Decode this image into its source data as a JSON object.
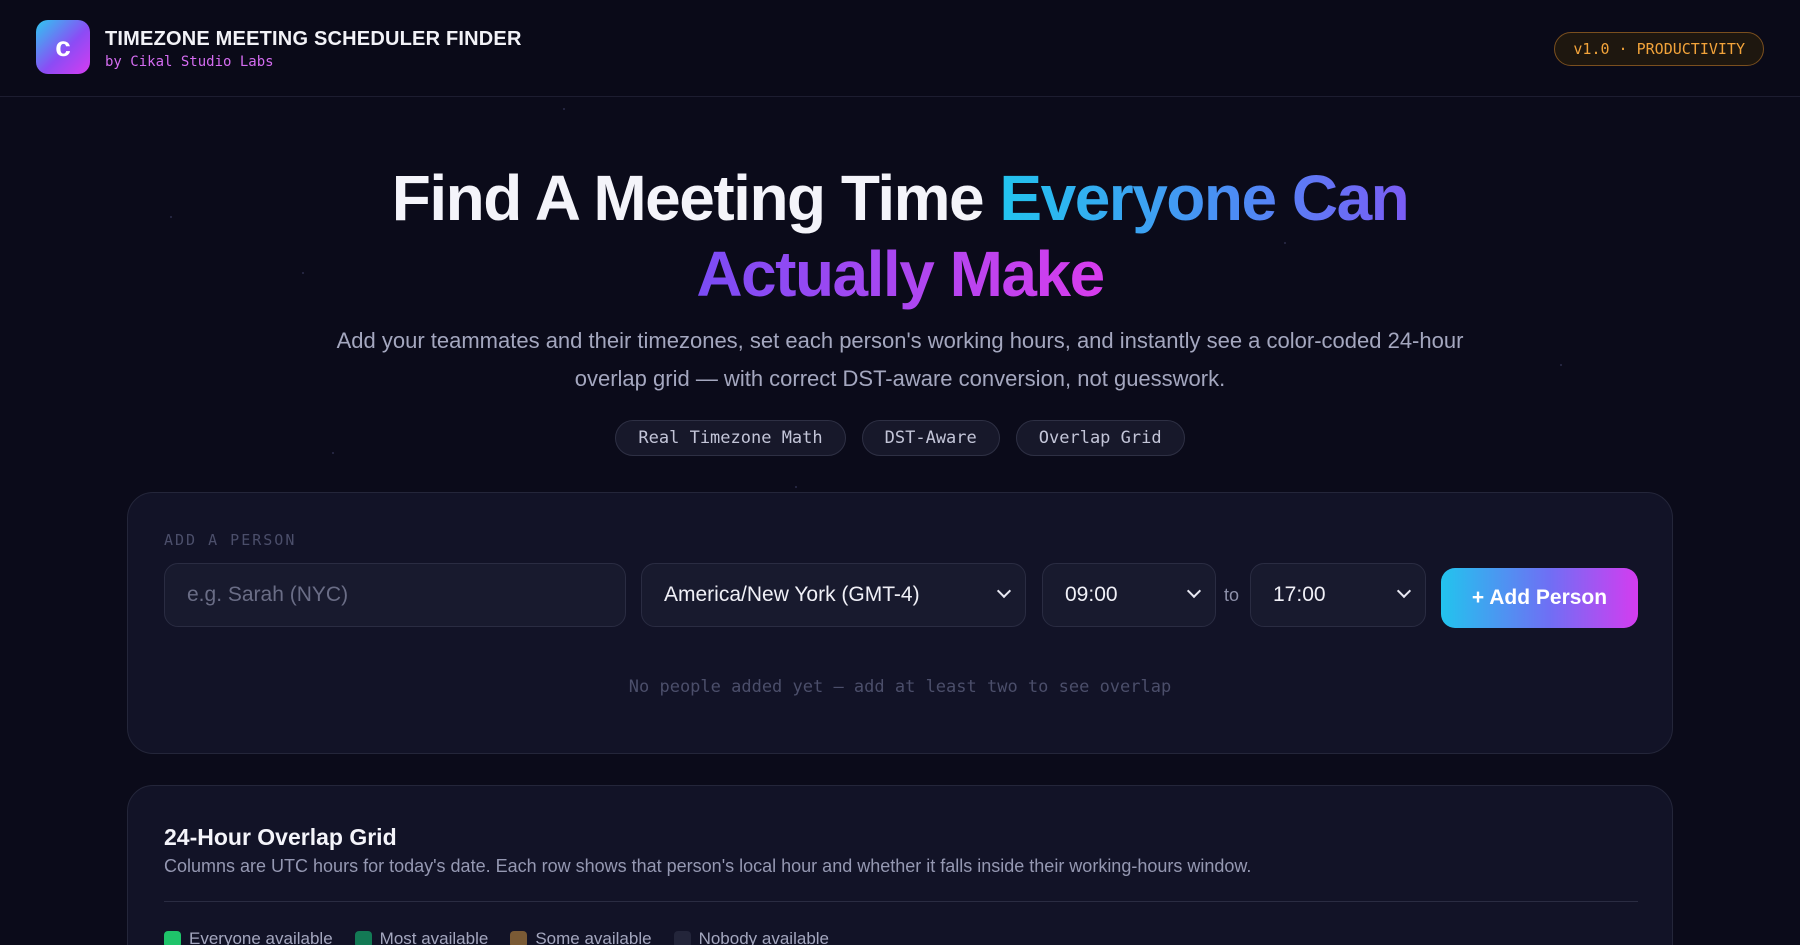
{
  "header": {
    "logo_letter": "c",
    "title": "TIMEZONE MEETING SCHEDULER FINDER",
    "subtitle": "by Cikal Studio Labs",
    "badge": "v1.0 · PRODUCTIVITY"
  },
  "hero": {
    "title_plain": "Find A Meeting Time ",
    "title_grad_a": "Everyone Can",
    "title_grad_b": "Actually Make",
    "description": "Add your teammates and their timezones, set each person's working hours, and instantly see a color-coded 24-hour overlap grid — with correct DST-aware conversion, not guesswork.",
    "pills": [
      "Real Timezone Math",
      "DST-Aware",
      "Overlap Grid"
    ]
  },
  "add_person": {
    "section_label": "ADD A PERSON",
    "name_placeholder": "e.g. Sarah (NYC)",
    "timezone_value": "America/New York (GMT-4)",
    "start_value": "09:00",
    "to_label": "to",
    "end_value": "17:00",
    "add_button": "+ Add Person",
    "empty_message": "No people added yet — add at least two to see overlap"
  },
  "overlap_grid": {
    "title": "24-Hour Overlap Grid",
    "description": "Columns are UTC hours for today's date. Each row shows that person's local hour and whether it falls inside their working-hours window.",
    "legend": [
      {
        "label": "Everyone available",
        "color": "#1fc46a"
      },
      {
        "label": "Most available",
        "color": "#137a55"
      },
      {
        "label": "Some available",
        "color": "#7a5a35"
      },
      {
        "label": "Nobody available",
        "color": "#23253a"
      }
    ]
  }
}
